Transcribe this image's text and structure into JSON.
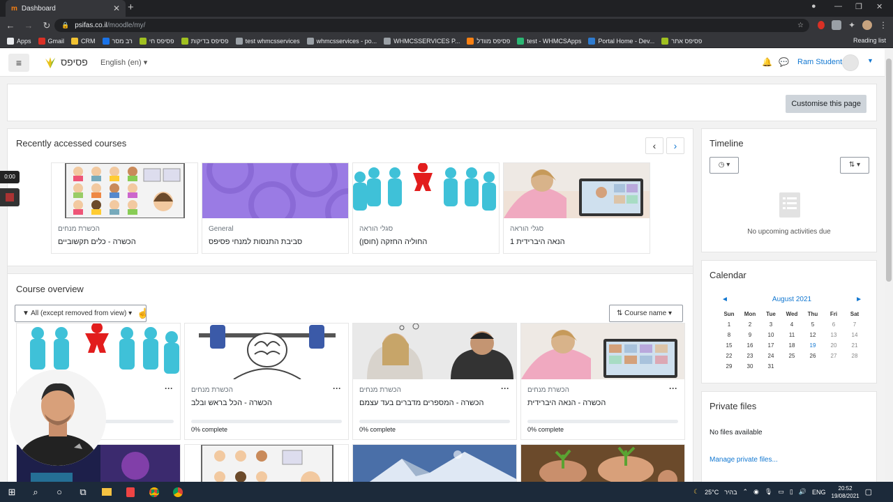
{
  "browser": {
    "tab_title": "Dashboard",
    "tab_close": "✕",
    "new_tab": "+",
    "url_host": "psifas.co.il",
    "url_path": "/moodle/my/",
    "bookmarks": [
      {
        "label": "Apps",
        "color": "#e8eaed"
      },
      {
        "label": "Gmail",
        "color": "#d93025"
      },
      {
        "label": "CRM",
        "color": "#f1c232"
      },
      {
        "label": "רב מסר",
        "color": "#1a73e8"
      },
      {
        "label": "פסיפס חי",
        "color": "#a0c020"
      },
      {
        "label": "פסיפס בדיקות",
        "color": "#a0c020"
      },
      {
        "label": "test whmcsservices",
        "color": "#9aa0a6"
      },
      {
        "label": "whmcsservices - po...",
        "color": "#9aa0a6"
      },
      {
        "label": "WHMCSSERVICES P...",
        "color": "#9aa0a6"
      },
      {
        "label": "פסיפס מוודל",
        "color": "#f98012"
      },
      {
        "label": "test - WHMCSApps",
        "color": "#2bb673"
      },
      {
        "label": "Portal Home - Dev...",
        "color": "#2e7bcf"
      },
      {
        "label": "פסיפס אתר",
        "color": "#a0c020"
      }
    ],
    "reading_list": "Reading list"
  },
  "navbar": {
    "menu_icon": "≡",
    "site_name": "פסיפס",
    "language": "English (en)",
    "user_name": "Ram Student"
  },
  "customise_button": "Customise this page",
  "recent": {
    "title": "Recently accessed courses",
    "courses": [
      {
        "category": "הכשרת מנחים",
        "name": "הכשרה - כלים תקשוביים"
      },
      {
        "category": "General",
        "name": "סביבת התנסות למנחי פסיפס"
      },
      {
        "category": "סגלי הוראה",
        "name": "החוליה החזקה (חוסן)"
      },
      {
        "category": "סגלי הוראה",
        "name": "הנאה היברידית 1"
      }
    ]
  },
  "overview": {
    "title": "Course overview",
    "filter": "All (except removed from view)",
    "sort": "Course name",
    "courses": [
      {
        "category": "",
        "name": "",
        "progress": ""
      },
      {
        "category": "הכשרת מנחים",
        "name": "הכשרה - הכל בראש ובלב",
        "progress": "0% complete"
      },
      {
        "category": "הכשרת מנחים",
        "name": "הכשרה - המספרים מדברים בעד עצמם",
        "progress": "0% complete"
      },
      {
        "category": "הכשרת מנחים",
        "name": "הכשרה - הנאה היברידית",
        "progress": "0% complete"
      }
    ]
  },
  "timeline": {
    "title": "Timeline",
    "empty": "No upcoming activities due"
  },
  "calendar": {
    "title": "Calendar",
    "month": "August 2021",
    "prev": "◄",
    "next": "►",
    "days": [
      "Sun",
      "Mon",
      "Tue",
      "Wed",
      "Thu",
      "Fri",
      "Sat"
    ],
    "weeks": [
      [
        "1",
        "2",
        "3",
        "4",
        "5",
        "6",
        "7"
      ],
      [
        "8",
        "9",
        "10",
        "11",
        "12",
        "13",
        "14"
      ],
      [
        "15",
        "16",
        "17",
        "18",
        "19",
        "20",
        "21"
      ],
      [
        "22",
        "23",
        "24",
        "25",
        "26",
        "27",
        "28"
      ],
      [
        "29",
        "30",
        "31",
        "",
        "",
        "",
        ""
      ]
    ],
    "today": "19"
  },
  "private_files": {
    "title": "Private files",
    "empty": "No files available",
    "manage": "Manage private files..."
  },
  "recorder": {
    "time": "0:00"
  },
  "taskbar": {
    "weather": "25°C",
    "weather_text": "בהיר",
    "lang": "ENG",
    "time": "20:52",
    "date": "19/08/2021"
  }
}
